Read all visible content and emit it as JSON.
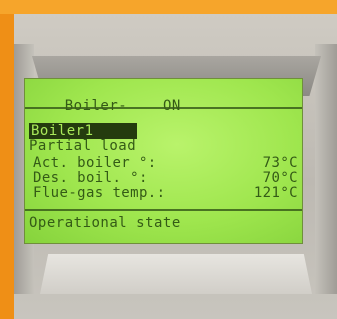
{
  "lcd": {
    "header_label": "Boiler-",
    "header_state": "ON",
    "selected_item": "Boiler1",
    "mode": "Partial load",
    "rows": [
      {
        "label": "Act. boiler °:",
        "value": "73°C"
      },
      {
        "label": "Des. boil. °:",
        "value": "70°C"
      },
      {
        "label": "Flue-gas temp.:",
        "value": "121°C"
      }
    ],
    "footer": "Operational state"
  }
}
